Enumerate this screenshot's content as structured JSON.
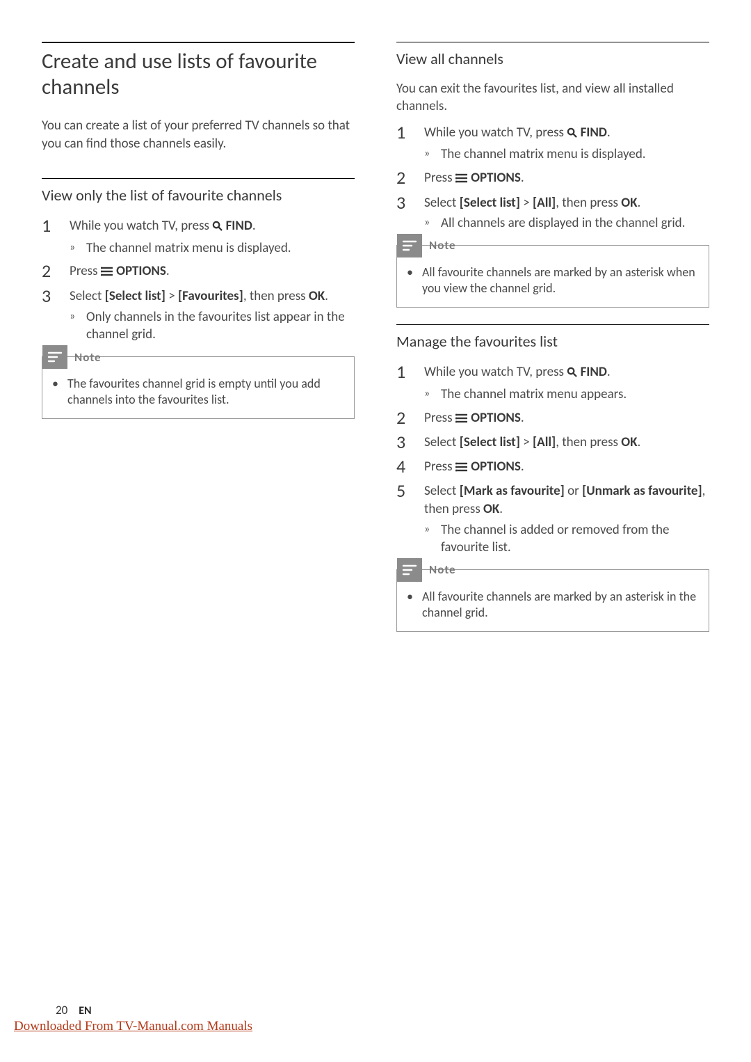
{
  "main_title": "Create and use lists of favourite channels",
  "main_intro": "You can create a list of your preferred TV channels so that you can find those channels easily.",
  "sec1": {
    "title": "View only the list of favourite channels",
    "steps": {
      "1": {
        "a": "While you watch TV, press ",
        "b": " FIND",
        "c": ".",
        "r": "The channel matrix menu is displayed."
      },
      "2": {
        "a": "Press ",
        "b": " OPTIONS",
        "c": "."
      },
      "3": {
        "a": "Select ",
        "b": "[Select list]",
        "c": " > ",
        "d": "[Favourites]",
        "e": ", then press ",
        "f": "OK",
        "g": ".",
        "r": "Only channels in the favourites list appear in the channel grid."
      }
    },
    "note": "The favourites channel grid is empty until you add channels into the favourites list."
  },
  "sec2": {
    "title": "View all channels",
    "intro": "You can exit the favourites list, and view all installed channels.",
    "steps": {
      "1": {
        "a": "While you watch TV, press ",
        "b": " FIND",
        "c": ".",
        "r": "The channel matrix menu is displayed."
      },
      "2": {
        "a": "Press ",
        "b": " OPTIONS",
        "c": "."
      },
      "3": {
        "a": "Select ",
        "b": "[Select list]",
        "c": " > ",
        "d": "[All]",
        "e": ", then press ",
        "f": "OK",
        "g": ".",
        "r": "All channels are displayed in the channel grid."
      }
    },
    "note": "All favourite channels are marked by an asterisk when you view the channel grid."
  },
  "sec3": {
    "title": "Manage the favourites list",
    "steps": {
      "1": {
        "a": "While you watch TV, press ",
        "b": " FIND",
        "c": ".",
        "r": "The channel matrix menu appears."
      },
      "2": {
        "a": "Press ",
        "b": " OPTIONS",
        "c": "."
      },
      "3": {
        "a": "Select ",
        "b": "[Select list]",
        "c": " > ",
        "d": "[All]",
        "e": ", then press ",
        "f": "OK",
        "g": "."
      },
      "4": {
        "a": "Press ",
        "b": " OPTIONS",
        "c": "."
      },
      "5": {
        "a": "Select ",
        "b": "[Mark as favourite]",
        "c": " or ",
        "d": "[Unmark as favourite]",
        "e": ", then press ",
        "f": "OK",
        "g": ".",
        "r": "The channel is added or removed from the favourite list."
      }
    },
    "note": "All favourite channels are marked by an asterisk in the channel grid."
  },
  "note_label": "Note",
  "arrow_glyph": "»",
  "page_number": "20",
  "language": "EN",
  "footer_link": "Downloaded From TV-Manual.com Manuals"
}
